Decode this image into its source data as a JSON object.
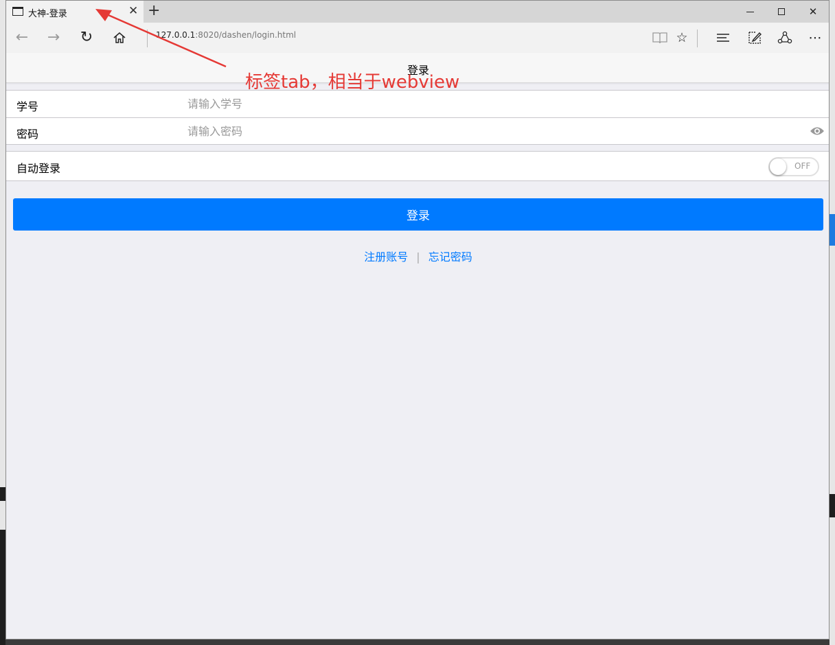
{
  "browser": {
    "tab_title": "大神-登录",
    "new_tab": "+",
    "url_host": "127.0.0.1",
    "url_rest": ":8020/dashen/login.html"
  },
  "page": {
    "title": "登录"
  },
  "annotation": {
    "text": "标签tab，相当于webview",
    "color": "#e53935"
  },
  "form": {
    "student_id": {
      "label": "学号",
      "placeholder": "请输入学号",
      "value": ""
    },
    "password": {
      "label": "密码",
      "placeholder": "请输入密码",
      "value": ""
    },
    "auto_login": {
      "label": "自动登录",
      "toggle_text": "OFF",
      "on": false
    }
  },
  "actions": {
    "login_label": "登录",
    "register_label": "注册账号",
    "divider": "|",
    "forgot_label": "忘记密码"
  },
  "colors": {
    "primary": "#007aff",
    "background": "#efeff4"
  }
}
